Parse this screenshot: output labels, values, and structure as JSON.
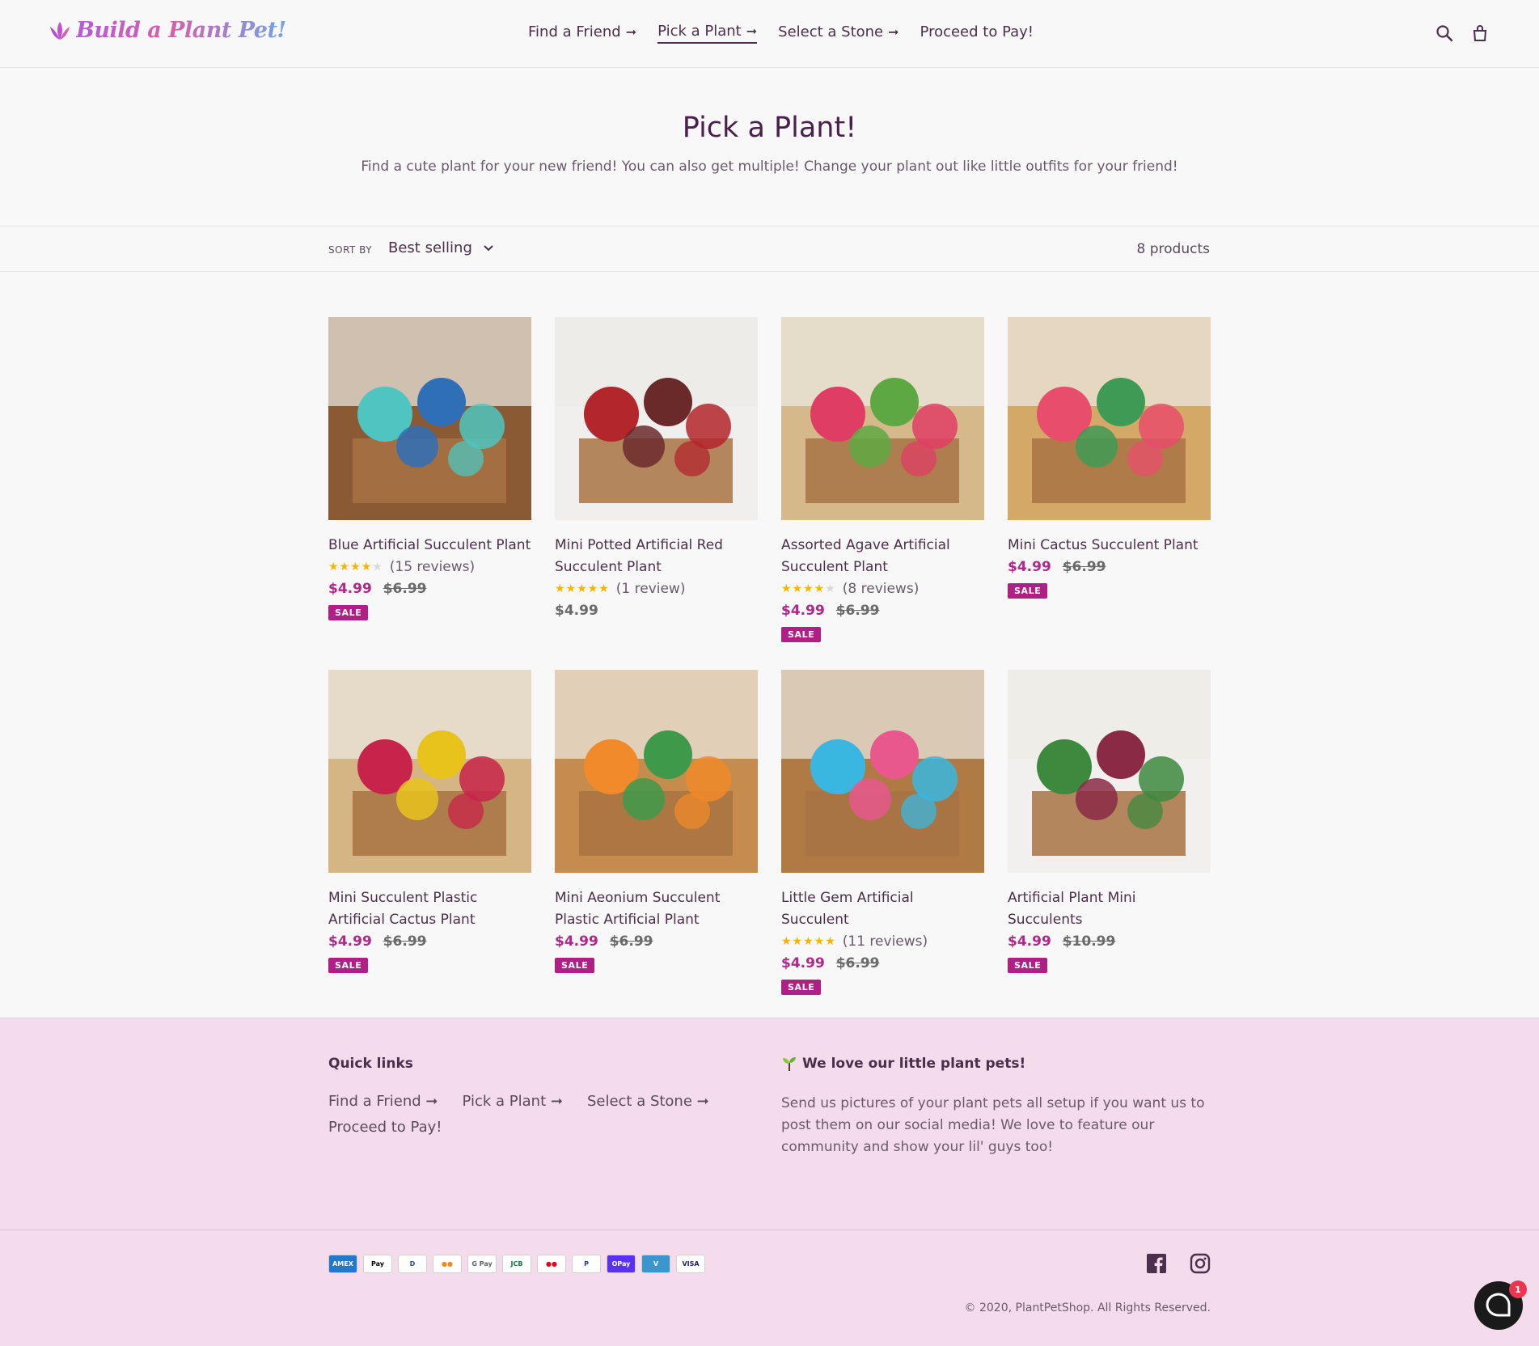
{
  "brand": {
    "name": "Build a Plant Pet!"
  },
  "nav": {
    "items": [
      {
        "label": "Find a Friend",
        "arrow": "➞",
        "active": false
      },
      {
        "label": "Pick a Plant",
        "arrow": "➞",
        "active": true
      },
      {
        "label": "Select a Stone",
        "arrow": "➞",
        "active": false
      },
      {
        "label": "Proceed to Pay!",
        "arrow": "",
        "active": false
      }
    ],
    "icons": [
      "search-icon",
      "cart-icon"
    ]
  },
  "page": {
    "title": "Pick a Plant!",
    "subtitle": "Find a cute plant for your new friend! You can also get multiple! Change your plant out like little outfits for your friend!"
  },
  "filter": {
    "sort_label": "SORT BY",
    "sort_value": "Best selling",
    "count": "8 products"
  },
  "products": [
    {
      "title": "Blue Artificial Succulent Plant",
      "rating": 4,
      "reviews": "(15 reviews)",
      "price": "$4.99",
      "compare": "$6.99",
      "badge": "SALE",
      "colors": [
        "#4ec5c0",
        "#2f6fb8",
        "#8a5a34"
      ]
    },
    {
      "title": "Mini Potted Artificial Red Succulent Plant",
      "rating": 5,
      "reviews": "(1 review)",
      "price": "$4.99",
      "compare": "",
      "badge": "",
      "colors": [
        "#b3262b",
        "#6a2a2a",
        "#f1eeee"
      ]
    },
    {
      "title": "Assorted Agave Artificial Succulent Plant",
      "rating": 4,
      "reviews": "(8 reviews)",
      "price": "$4.99",
      "compare": "$6.99",
      "badge": "SALE",
      "colors": [
        "#e03d64",
        "#5ea843",
        "#d6b98a"
      ]
    },
    {
      "title": "Mini Cactus Succulent Plant",
      "rating": 0,
      "reviews": "",
      "price": "$4.99",
      "compare": "$6.99",
      "badge": "SALE",
      "colors": [
        "#e84e6b",
        "#3e9b55",
        "#d4a968"
      ]
    },
    {
      "title": "Mini Succulent Plastic Artificial Cactus Plant",
      "rating": 0,
      "reviews": "",
      "price": "$4.99",
      "compare": "$6.99",
      "badge": "SALE",
      "colors": [
        "#c8234a",
        "#e8c31c",
        "#d4b583"
      ]
    },
    {
      "title": "Mini Aeonium Succulent Plastic Artificial Plant",
      "rating": 0,
      "reviews": "",
      "price": "$4.99",
      "compare": "$6.99",
      "badge": "SALE",
      "colors": [
        "#f08a2a",
        "#3e9a4a",
        "#c68c4e"
      ]
    },
    {
      "title": "Little Gem Artificial Succulent",
      "rating": 5,
      "reviews": "(11 reviews)",
      "price": "$4.99",
      "compare": "$6.99",
      "badge": "SALE",
      "colors": [
        "#39b7e0",
        "#e8588d",
        "#b07a45"
      ]
    },
    {
      "title": "Artificial Plant Mini Succulents",
      "rating": 0,
      "reviews": "",
      "price": "$4.99",
      "compare": "$10.99",
      "badge": "SALE",
      "colors": [
        "#3d8a3e",
        "#8a2a45",
        "#f2f0ee"
      ]
    }
  ],
  "footer": {
    "quick_links_heading": "Quick links",
    "quick_links": [
      {
        "label": "Find a Friend ➞"
      },
      {
        "label": "Pick a Plant ➞"
      },
      {
        "label": "Select a Stone ➞"
      },
      {
        "label": "Proceed to Pay!"
      }
    ],
    "love_heading": "We love our little plant pets!",
    "love_text": "Send us pictures of your plant pets all setup if you want us to post them on our social media! We love to feature our community and show your lil' guys too!",
    "payments": [
      "AMEX",
      "Pay",
      "D",
      "●●",
      "G Pay",
      "JCB",
      "●●",
      "P",
      "OPay",
      "V",
      "VISA"
    ],
    "copyright": "© 2020, PlantPetShop. All Rights Reserved.",
    "chat_badge": "1"
  },
  "colors": {
    "accent": "#b0288b",
    "footer_bg": "#f4dcec",
    "star": "#f5b400",
    "heading": "#4b1f4b"
  }
}
